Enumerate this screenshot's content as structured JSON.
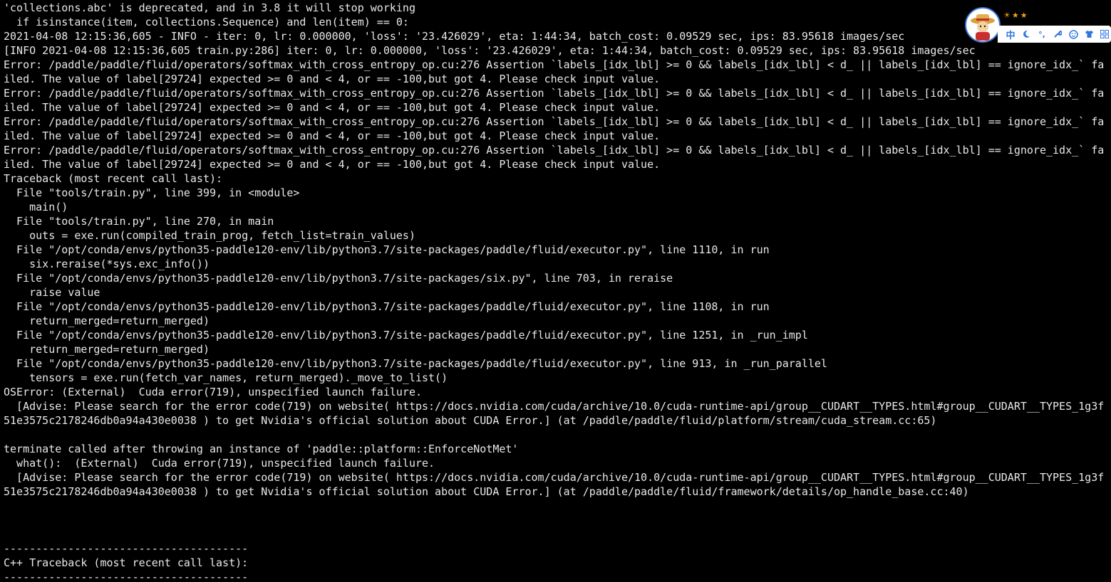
{
  "terminal": {
    "lines": [
      "'collections.abc' is deprecated, and in 3.8 it will stop working",
      "  if isinstance(item, collections.Sequence) and len(item) == 0:",
      "2021-04-08 12:15:36,605 - INFO - iter: 0, lr: 0.000000, 'loss': '23.426029', eta: 1:44:34, batch_cost: 0.09529 sec, ips: 83.95618 images/sec",
      "[INFO 2021-04-08 12:15:36,605 train.py:286] iter: 0, lr: 0.000000, 'loss': '23.426029', eta: 1:44:34, batch_cost: 0.09529 sec, ips: 83.95618 images/sec",
      "Error: /paddle/paddle/fluid/operators/softmax_with_cross_entropy_op.cu:276 Assertion `labels_[idx_lbl] >= 0 && labels_[idx_lbl] < d_ || labels_[idx_lbl] == ignore_idx_` fa",
      "iled. The value of label[29724] expected >= 0 and < 4, or == -100,but got 4. Please check input value.",
      "Error: /paddle/paddle/fluid/operators/softmax_with_cross_entropy_op.cu:276 Assertion `labels_[idx_lbl] >= 0 && labels_[idx_lbl] < d_ || labels_[idx_lbl] == ignore_idx_` fa",
      "iled. The value of label[29724] expected >= 0 and < 4, or == -100,but got 4. Please check input value.",
      "Error: /paddle/paddle/fluid/operators/softmax_with_cross_entropy_op.cu:276 Assertion `labels_[idx_lbl] >= 0 && labels_[idx_lbl] < d_ || labels_[idx_lbl] == ignore_idx_` fa",
      "iled. The value of label[29724] expected >= 0 and < 4, or == -100,but got 4. Please check input value.",
      "Error: /paddle/paddle/fluid/operators/softmax_with_cross_entropy_op.cu:276 Assertion `labels_[idx_lbl] >= 0 && labels_[idx_lbl] < d_ || labels_[idx_lbl] == ignore_idx_` fa",
      "iled. The value of label[29724] expected >= 0 and < 4, or == -100,but got 4. Please check input value.",
      "Traceback (most recent call last):",
      "  File \"tools/train.py\", line 399, in <module>",
      "    main()",
      "  File \"tools/train.py\", line 270, in main",
      "    outs = exe.run(compiled_train_prog, fetch_list=train_values)",
      "  File \"/opt/conda/envs/python35-paddle120-env/lib/python3.7/site-packages/paddle/fluid/executor.py\", line 1110, in run",
      "    six.reraise(*sys.exc_info())",
      "  File \"/opt/conda/envs/python35-paddle120-env/lib/python3.7/site-packages/six.py\", line 703, in reraise",
      "    raise value",
      "  File \"/opt/conda/envs/python35-paddle120-env/lib/python3.7/site-packages/paddle/fluid/executor.py\", line 1108, in run",
      "    return_merged=return_merged)",
      "  File \"/opt/conda/envs/python35-paddle120-env/lib/python3.7/site-packages/paddle/fluid/executor.py\", line 1251, in _run_impl",
      "    return_merged=return_merged)",
      "  File \"/opt/conda/envs/python35-paddle120-env/lib/python3.7/site-packages/paddle/fluid/executor.py\", line 913, in _run_parallel",
      "    tensors = exe.run(fetch_var_names, return_merged)._move_to_list()",
      "OSError: (External)  Cuda error(719), unspecified launch failure.",
      "  [Advise: Please search for the error code(719) on website( https://docs.nvidia.com/cuda/archive/10.0/cuda-runtime-api/group__CUDART__TYPES.html#group__CUDART__TYPES_1g3f",
      "51e3575c2178246db0a94a430e0038 ) to get Nvidia's official solution about CUDA Error.] (at /paddle/paddle/fluid/platform/stream/cuda_stream.cc:65)",
      "",
      "terminate called after throwing an instance of 'paddle::platform::EnforceNotMet'",
      "  what():  (External)  Cuda error(719), unspecified launch failure.",
      "  [Advise: Please search for the error code(719) on website( https://docs.nvidia.com/cuda/archive/10.0/cuda-runtime-api/group__CUDART__TYPES.html#group__CUDART__TYPES_1g3f",
      "51e3575c2178246db0a94a430e0038 ) to get Nvidia's official solution about CUDA Error.] (at /paddle/paddle/fluid/framework/details/op_handle_base.cc:40)",
      "",
      "",
      "",
      "--------------------------------------",
      "C++ Traceback (most recent call last):",
      "--------------------------------------"
    ]
  },
  "ime": {
    "mode_label": "中",
    "icons": [
      "avatar-icon",
      "sun-icon",
      "star-icon",
      "star-icon",
      "moon-icon",
      "punctuation-icon",
      "wrench-icon",
      "smiley-icon",
      "shirt-icon",
      "grid-icon"
    ],
    "accent_color": "#2f76e0"
  },
  "colors": {
    "background": "#000000",
    "text": "#e8e8e8"
  }
}
